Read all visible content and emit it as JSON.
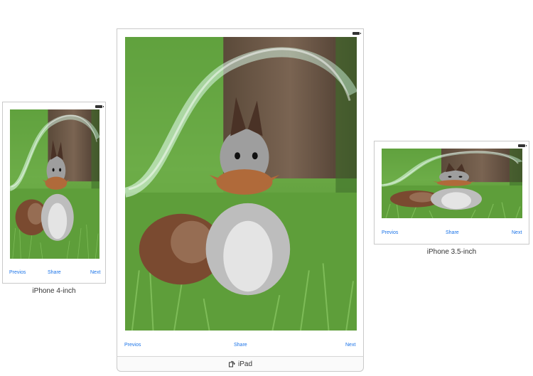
{
  "devices": {
    "iphone4": {
      "label": "iPhone 4-inch",
      "toolbar": {
        "prev": "Previos",
        "share": "Share",
        "next": "Next"
      }
    },
    "ipad": {
      "label": "iPad",
      "toolbar": {
        "prev": "Previos",
        "share": "Share",
        "next": "Next"
      }
    },
    "iphone35": {
      "label": "iPhone 3.5-inch",
      "toolbar": {
        "prev": "Previos",
        "share": "Share",
        "next": "Next"
      }
    }
  },
  "colors": {
    "toolbar_button": "#1a73e8",
    "grass": "#5a9a3a",
    "squirrel_body": "#b8b8b8",
    "squirrel_ears": "#8a4a26"
  },
  "icons": {
    "rotate": "rotate-device-icon",
    "battery": "battery-icon"
  }
}
